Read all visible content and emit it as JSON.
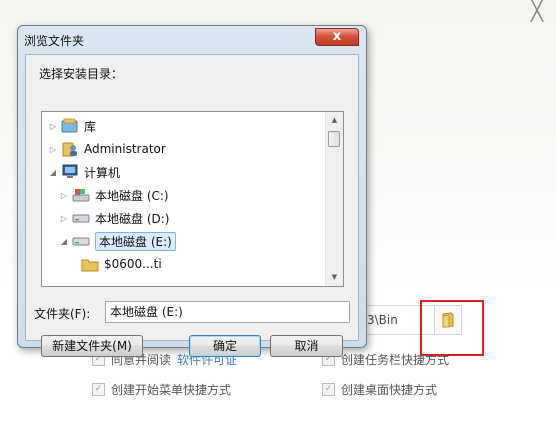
{
  "dialog": {
    "title": "浏览文件夹",
    "close_glyph": "x",
    "select_label": "选择安装目录：",
    "tree_items": [
      {
        "label": "库",
        "icon": "library-icon",
        "expander": "▷"
      },
      {
        "label": "Administrator",
        "icon": "user-folder-icon",
        "expander": "▷"
      },
      {
        "label": "计算机",
        "icon": "computer-icon",
        "expander": "◢"
      },
      {
        "label": "本地磁盘 (C:)",
        "icon": "system-drive-icon",
        "expander": "▷"
      },
      {
        "label": "本地磁盘 (D:)",
        "icon": "drive-icon",
        "expander": "▷"
      },
      {
        "label": "本地磁盘 (E:)",
        "icon": "drive-icon",
        "expander": "◢",
        "selected": true
      },
      {
        "label": "$0600...ti",
        "icon": "folder-icon",
        "expander": ""
      }
    ],
    "folder_field_label": "文件夹(F):",
    "folder_field_value": "本地磁盘 (E:)",
    "new_folder_button": "新建文件夹(M)",
    "ok_button": "确定",
    "cancel_button": "取消"
  },
  "installer": {
    "close_glyph": "╳",
    "path_value": "3\\Bin",
    "browse_icon": "folder-icon",
    "options": {
      "agree_label": "同意并阅读",
      "license_link": "软件许可证",
      "taskbar_shortcut": "创建任务栏快捷方式",
      "startmenu_shortcut": "创建开始菜单快捷方式",
      "desktop_shortcut": "创建桌面快捷方式"
    },
    "highlight_color": "#e02020"
  }
}
